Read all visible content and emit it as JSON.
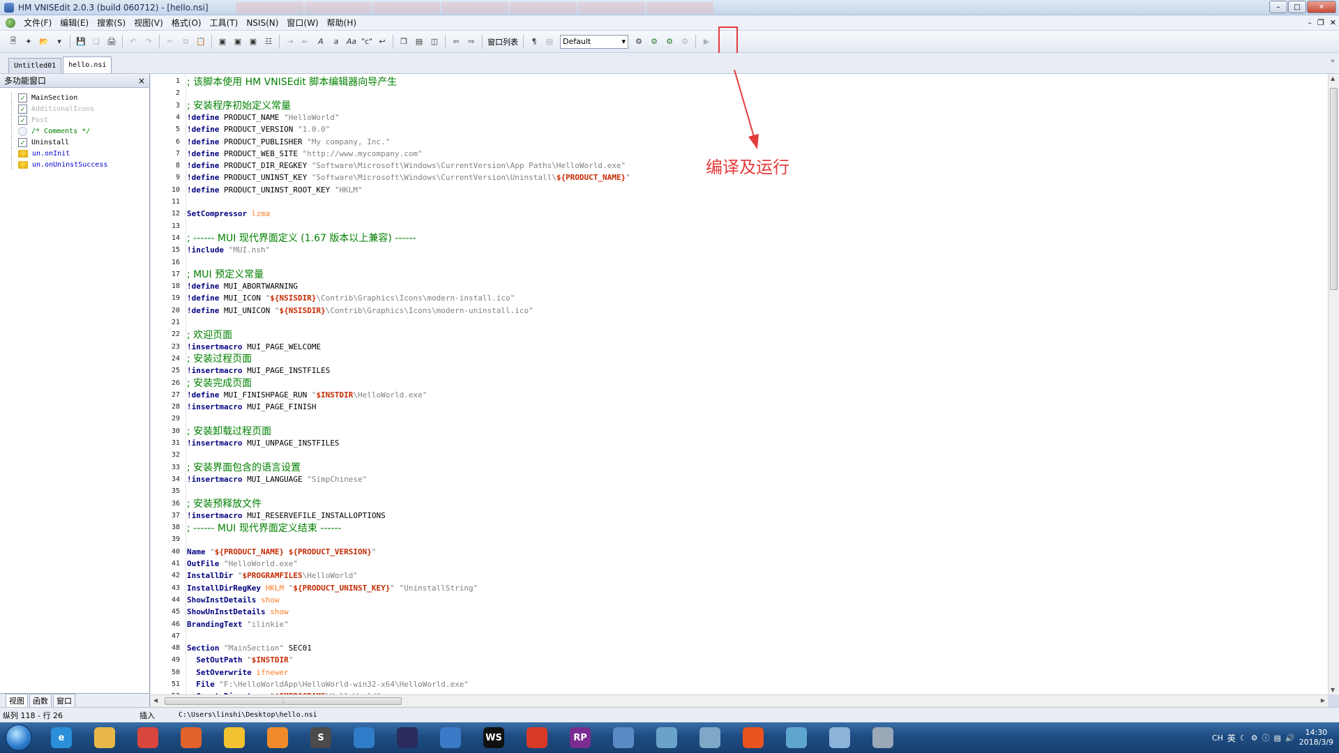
{
  "window": {
    "title": "HM VNISEdit 2.0.3 (build 060712) - [hello.nsi]"
  },
  "menu": [
    "文件(F)",
    "编辑(E)",
    "搜索(S)",
    "视图(V)",
    "格式(O)",
    "工具(T)",
    "NSIS(N)",
    "窗口(W)",
    "帮助(H)"
  ],
  "toolbar": {
    "window_list_label": "窗口列表",
    "scheme_select_value": "Default"
  },
  "doc_tabs": [
    "Untitled01",
    "hello.nsi"
  ],
  "left_panel": {
    "title": "多功能窗口",
    "close_glyph": "×",
    "tree": [
      {
        "label": "MainSection",
        "kind": "checked",
        "color": "#000000"
      },
      {
        "label": "AdditionalIcons",
        "kind": "checked",
        "color": "#b0b0b0"
      },
      {
        "label": "Post",
        "kind": "checked",
        "color": "#b0b0b0"
      },
      {
        "label": "/* Comments */",
        "kind": "comment",
        "color": "#008000"
      },
      {
        "label": "Uninstall",
        "kind": "checked",
        "color": "#000000"
      },
      {
        "label": "un.onInit",
        "kind": "function",
        "color": "#0000cc"
      },
      {
        "label": "un.onUninstSuccess",
        "kind": "function",
        "color": "#0000cc"
      }
    ],
    "bottom_tabs": [
      "视图",
      "函数",
      "窗口"
    ]
  },
  "editor": {
    "lines": [
      {
        "n": "1",
        "segs": [
          {
            "t": "; 该脚本使用 HM VNISEdit 脚本编辑器向导产生",
            "c": "cmt"
          }
        ]
      },
      {
        "n": "2",
        "segs": []
      },
      {
        "n": "3",
        "segs": [
          {
            "t": "; 安装程序初始定义常量",
            "c": "cmt"
          }
        ]
      },
      {
        "n": "4",
        "segs": [
          {
            "t": "!define",
            "c": "kw"
          },
          {
            "t": " PRODUCT_NAME ",
            "c": "plain"
          },
          {
            "t": "\"HelloWorld\"",
            "c": "str"
          }
        ]
      },
      {
        "n": "5",
        "segs": [
          {
            "t": "!define",
            "c": "kw"
          },
          {
            "t": " PRODUCT_VERSION ",
            "c": "plain"
          },
          {
            "t": "\"1.0.0\"",
            "c": "str"
          }
        ]
      },
      {
        "n": "6",
        "segs": [
          {
            "t": "!define",
            "c": "kw"
          },
          {
            "t": " PRODUCT_PUBLISHER ",
            "c": "plain"
          },
          {
            "t": "\"My company, Inc.\"",
            "c": "str"
          }
        ]
      },
      {
        "n": "7",
        "segs": [
          {
            "t": "!define",
            "c": "kw"
          },
          {
            "t": " PRODUCT_WEB_SITE ",
            "c": "plain"
          },
          {
            "t": "\"http://www.mycompany.com\"",
            "c": "str"
          }
        ]
      },
      {
        "n": "8",
        "segs": [
          {
            "t": "!define",
            "c": "kw"
          },
          {
            "t": " PRODUCT_DIR_REGKEY ",
            "c": "plain"
          },
          {
            "t": "\"Software\\Microsoft\\Windows\\CurrentVersion\\App Paths\\HelloWorld.exe\"",
            "c": "str"
          }
        ]
      },
      {
        "n": "9",
        "segs": [
          {
            "t": "!define",
            "c": "kw"
          },
          {
            "t": " PRODUCT_UNINST_KEY ",
            "c": "plain"
          },
          {
            "t": "\"Software\\Microsoft\\Windows\\CurrentVersion\\Uninstall\\",
            "c": "str"
          },
          {
            "t": "${PRODUCT_NAME}",
            "c": "var"
          },
          {
            "t": "\"",
            "c": "str"
          }
        ]
      },
      {
        "n": "10",
        "segs": [
          {
            "t": "!define",
            "c": "kw"
          },
          {
            "t": " PRODUCT_UNINST_ROOT_KEY ",
            "c": "plain"
          },
          {
            "t": "\"HKLM\"",
            "c": "str"
          }
        ]
      },
      {
        "n": "11",
        "segs": []
      },
      {
        "n": "12",
        "segs": [
          {
            "t": "SetCompressor",
            "c": "kw"
          },
          {
            "t": " ",
            "c": "plain"
          },
          {
            "t": "lzma",
            "c": "opt"
          }
        ]
      },
      {
        "n": "13",
        "segs": []
      },
      {
        "n": "14",
        "segs": [
          {
            "t": "; ------ MUI 现代界面定义 (1.67 版本以上兼容) ------",
            "c": "cmt"
          }
        ]
      },
      {
        "n": "15",
        "segs": [
          {
            "t": "!include",
            "c": "kw"
          },
          {
            "t": " ",
            "c": "plain"
          },
          {
            "t": "\"MUI.nsh\"",
            "c": "str"
          }
        ]
      },
      {
        "n": "16",
        "segs": []
      },
      {
        "n": "17",
        "segs": [
          {
            "t": "; MUI 预定义常量",
            "c": "cmt"
          }
        ]
      },
      {
        "n": "18",
        "segs": [
          {
            "t": "!define",
            "c": "kw"
          },
          {
            "t": " MUI_ABORTWARNING",
            "c": "plain"
          }
        ]
      },
      {
        "n": "19",
        "segs": [
          {
            "t": "!define",
            "c": "kw"
          },
          {
            "t": " MUI_ICON ",
            "c": "plain"
          },
          {
            "t": "\"",
            "c": "str"
          },
          {
            "t": "${NSISDIR}",
            "c": "var"
          },
          {
            "t": "\\Contrib\\Graphics\\Icons\\modern-install.ico\"",
            "c": "str"
          }
        ]
      },
      {
        "n": "20",
        "segs": [
          {
            "t": "!define",
            "c": "kw"
          },
          {
            "t": " MUI_UNICON ",
            "c": "plain"
          },
          {
            "t": "\"",
            "c": "str"
          },
          {
            "t": "${NSISDIR}",
            "c": "var"
          },
          {
            "t": "\\Contrib\\Graphics\\Icons\\modern-uninstall.ico\"",
            "c": "str"
          }
        ]
      },
      {
        "n": "21",
        "segs": []
      },
      {
        "n": "22",
        "segs": [
          {
            "t": "; 欢迎页面",
            "c": "cmt"
          }
        ]
      },
      {
        "n": "23",
        "segs": [
          {
            "t": "!insertmacro",
            "c": "kw"
          },
          {
            "t": " MUI_PAGE_WELCOME",
            "c": "plain"
          }
        ]
      },
      {
        "n": "24",
        "segs": [
          {
            "t": "; 安装过程页面",
            "c": "cmt"
          }
        ]
      },
      {
        "n": "25",
        "segs": [
          {
            "t": "!insertmacro",
            "c": "kw"
          },
          {
            "t": " MUI_PAGE_INSTFILES",
            "c": "plain"
          }
        ]
      },
      {
        "n": "26",
        "segs": [
          {
            "t": "; 安装完成页面",
            "c": "cmt"
          }
        ]
      },
      {
        "n": "27",
        "segs": [
          {
            "t": "!define",
            "c": "kw"
          },
          {
            "t": " MUI_FINISHPAGE_RUN ",
            "c": "plain"
          },
          {
            "t": "\"",
            "c": "str"
          },
          {
            "t": "$INSTDIR",
            "c": "var"
          },
          {
            "t": "\\HelloWorld.exe\"",
            "c": "str"
          }
        ]
      },
      {
        "n": "28",
        "segs": [
          {
            "t": "!insertmacro",
            "c": "kw"
          },
          {
            "t": " MUI_PAGE_FINISH",
            "c": "plain"
          }
        ]
      },
      {
        "n": "29",
        "segs": []
      },
      {
        "n": "30",
        "segs": [
          {
            "t": "; 安装卸载过程页面",
            "c": "cmt"
          }
        ]
      },
      {
        "n": "31",
        "segs": [
          {
            "t": "!insertmacro",
            "c": "kw"
          },
          {
            "t": " MUI_UNPAGE_INSTFILES",
            "c": "plain"
          }
        ]
      },
      {
        "n": "32",
        "segs": []
      },
      {
        "n": "33",
        "segs": [
          {
            "t": "; 安装界面包含的语言设置",
            "c": "cmt"
          }
        ]
      },
      {
        "n": "34",
        "segs": [
          {
            "t": "!insertmacro",
            "c": "kw"
          },
          {
            "t": " MUI_LANGUAGE ",
            "c": "plain"
          },
          {
            "t": "\"SimpChinese\"",
            "c": "str"
          }
        ]
      },
      {
        "n": "35",
        "segs": []
      },
      {
        "n": "36",
        "segs": [
          {
            "t": "; 安装预释放文件",
            "c": "cmt"
          }
        ]
      },
      {
        "n": "37",
        "segs": [
          {
            "t": "!insertmacro",
            "c": "kw"
          },
          {
            "t": " MUI_RESERVEFILE_INSTALLOPTIONS",
            "c": "plain"
          }
        ]
      },
      {
        "n": "38",
        "segs": [
          {
            "t": "; ------ MUI 现代界面定义结束 ------",
            "c": "cmt"
          }
        ]
      },
      {
        "n": "39",
        "segs": []
      },
      {
        "n": "40",
        "segs": [
          {
            "t": "Name",
            "c": "kw"
          },
          {
            "t": " ",
            "c": "plain"
          },
          {
            "t": "\"",
            "c": "str"
          },
          {
            "t": "${PRODUCT_NAME} ${PRODUCT_VERSION}",
            "c": "var"
          },
          {
            "t": "\"",
            "c": "str"
          }
        ]
      },
      {
        "n": "41",
        "segs": [
          {
            "t": "OutFile",
            "c": "kw"
          },
          {
            "t": " ",
            "c": "plain"
          },
          {
            "t": "\"HelloWorld.exe\"",
            "c": "str"
          }
        ]
      },
      {
        "n": "42",
        "segs": [
          {
            "t": "InstallDir",
            "c": "kw"
          },
          {
            "t": " ",
            "c": "plain"
          },
          {
            "t": "\"",
            "c": "str"
          },
          {
            "t": "$PROGRAMFILES",
            "c": "var"
          },
          {
            "t": "\\HelloWorld\"",
            "c": "str"
          }
        ]
      },
      {
        "n": "43",
        "segs": [
          {
            "t": "InstallDirRegKey",
            "c": "kw"
          },
          {
            "t": " ",
            "c": "plain"
          },
          {
            "t": "HKLM",
            "c": "opt"
          },
          {
            "t": " ",
            "c": "plain"
          },
          {
            "t": "\"",
            "c": "str"
          },
          {
            "t": "${PRODUCT_UNINST_KEY}",
            "c": "var"
          },
          {
            "t": "\" \"UninstallString\"",
            "c": "str"
          }
        ]
      },
      {
        "n": "44",
        "segs": [
          {
            "t": "ShowInstDetails",
            "c": "kw"
          },
          {
            "t": " ",
            "c": "plain"
          },
          {
            "t": "show",
            "c": "opt"
          }
        ]
      },
      {
        "n": "45",
        "segs": [
          {
            "t": "ShowUnInstDetails",
            "c": "kw"
          },
          {
            "t": " ",
            "c": "plain"
          },
          {
            "t": "show",
            "c": "opt"
          }
        ]
      },
      {
        "n": "46",
        "segs": [
          {
            "t": "BrandingText",
            "c": "kw"
          },
          {
            "t": " ",
            "c": "plain"
          },
          {
            "t": "\"ilinkie\"",
            "c": "str"
          }
        ]
      },
      {
        "n": "47",
        "segs": []
      },
      {
        "n": "48",
        "segs": [
          {
            "t": "Section",
            "c": "kw"
          },
          {
            "t": " ",
            "c": "plain"
          },
          {
            "t": "\"MainSection\"",
            "c": "str"
          },
          {
            "t": " SEC01",
            "c": "plain"
          }
        ]
      },
      {
        "n": "49",
        "segs": [
          {
            "t": "  SetOutPath",
            "c": "kw"
          },
          {
            "t": " ",
            "c": "plain"
          },
          {
            "t": "\"",
            "c": "str"
          },
          {
            "t": "$INSTDIR",
            "c": "var"
          },
          {
            "t": "\"",
            "c": "str"
          }
        ]
      },
      {
        "n": "50",
        "segs": [
          {
            "t": "  SetOverwrite",
            "c": "kw"
          },
          {
            "t": " ",
            "c": "plain"
          },
          {
            "t": "ifnewer",
            "c": "opt"
          }
        ]
      },
      {
        "n": "51",
        "segs": [
          {
            "t": "  File",
            "c": "kw"
          },
          {
            "t": " ",
            "c": "plain"
          },
          {
            "t": "\"F:\\HelloWorldApp\\HelloWorld-win32-x64\\HelloWorld.exe\"",
            "c": "str"
          }
        ]
      },
      {
        "n": "52",
        "segs": [
          {
            "t": "  CreateDirectory",
            "c": "kw"
          },
          {
            "t": " ",
            "c": "plain"
          },
          {
            "t": "\"",
            "c": "str"
          },
          {
            "t": "$SMPROGRAMS",
            "c": "var"
          },
          {
            "t": "\\HelloWorld\"",
            "c": "str"
          }
        ]
      }
    ]
  },
  "annotation": {
    "text": "编译及运行",
    "color": "#e53a3a"
  },
  "status": {
    "position": "纵列 118 - 行 26",
    "mode": "插入",
    "path": "C:\\Users\\linshi\\Desktop\\hello.nsi"
  },
  "taskbar": {
    "apps": [
      {
        "icon": "internet-explorer-icon",
        "color": "#2a8fd8",
        "glyph": "e"
      },
      {
        "icon": "file-explorer-icon",
        "color": "#e8b84a",
        "glyph": ""
      },
      {
        "icon": "chrome-icon",
        "color": "#d9463b",
        "glyph": ""
      },
      {
        "icon": "firefox-icon",
        "color": "#e2622b",
        "glyph": ""
      },
      {
        "icon": "app-yellow-icon",
        "color": "#f2c230",
        "glyph": ""
      },
      {
        "icon": "app-orange-icon",
        "color": "#f08a2a",
        "glyph": ""
      },
      {
        "icon": "sublime-text-icon",
        "color": "#4b4b4b",
        "glyph": "S"
      },
      {
        "icon": "vscode-icon",
        "color": "#2f7cc9",
        "glyph": ""
      },
      {
        "icon": "eclipse-icon",
        "color": "#2b2c5e",
        "glyph": ""
      },
      {
        "icon": "sourcetree-icon",
        "color": "#3a7ac6",
        "glyph": ""
      },
      {
        "icon": "webstorm-icon",
        "color": "#111111",
        "glyph": "WS"
      },
      {
        "icon": "app-red-icon",
        "color": "#d83a2a",
        "glyph": ""
      },
      {
        "icon": "axure-rp-icon",
        "color": "#7b2c91",
        "glyph": "RP"
      },
      {
        "icon": "app-globe-icon",
        "color": "#5b8bc6",
        "glyph": ""
      },
      {
        "icon": "app-notebook-icon",
        "color": "#6aa3c9",
        "glyph": ""
      },
      {
        "icon": "app-panel-icon",
        "color": "#7fa7c8",
        "glyph": ""
      },
      {
        "icon": "xmind-icon",
        "color": "#e8531f",
        "glyph": ""
      },
      {
        "icon": "app-react-icon",
        "color": "#5fa6cf",
        "glyph": ""
      },
      {
        "icon": "app-installer-icon",
        "color": "#8cb4d9",
        "glyph": ""
      },
      {
        "icon": "nsis-icon",
        "color": "#9aa8b8",
        "glyph": ""
      }
    ],
    "tray_lang": "英",
    "tray_ch": "CH",
    "time": "14:30",
    "date": "2018/3/9"
  }
}
